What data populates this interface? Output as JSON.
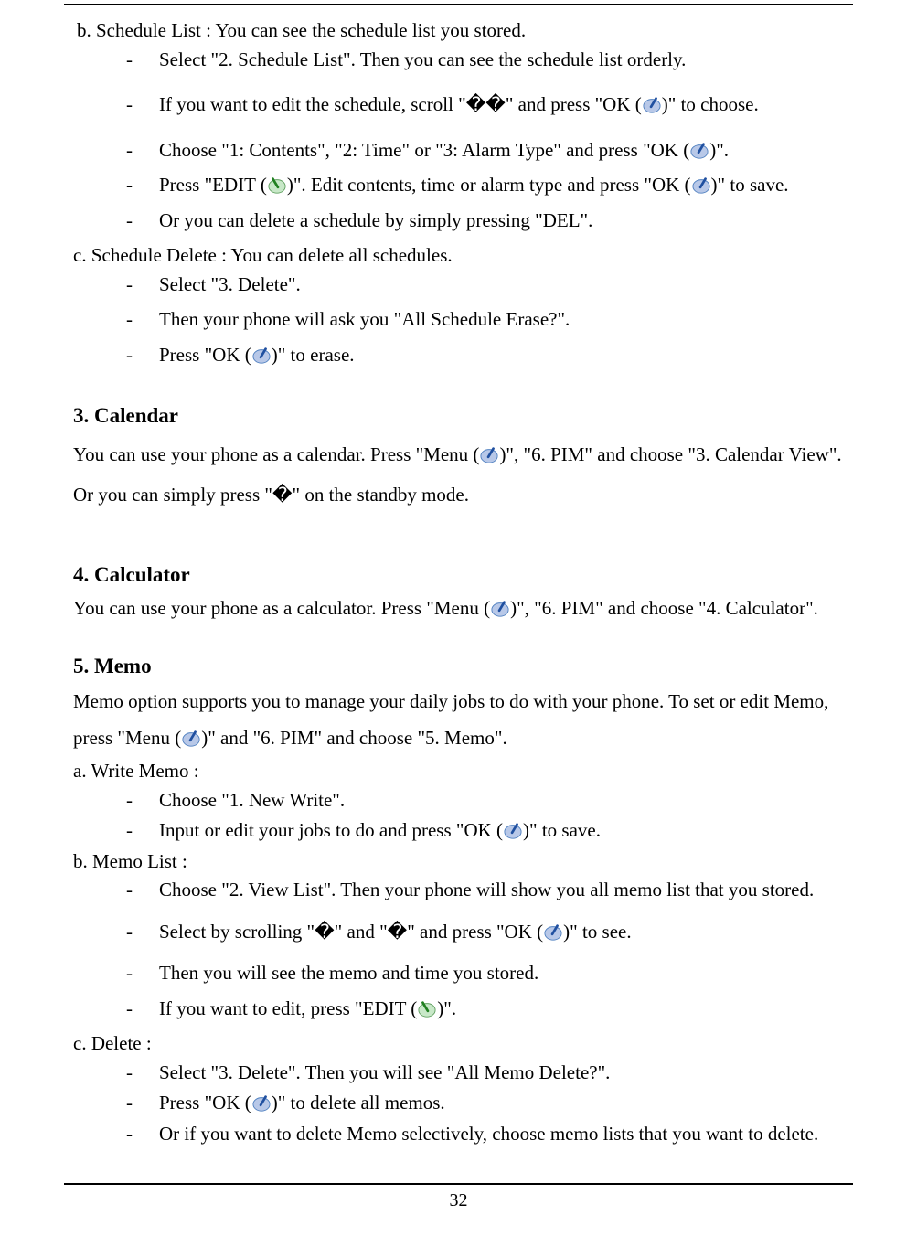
{
  "page_number": "32",
  "section_b": {
    "title": "b. Schedule List : You can see the schedule list you stored.",
    "items": [
      "Select \"2. Schedule List\". Then you can see the schedule list orderly.",
      "If you want to edit the schedule, scroll \"��\" and press \"OK ( )\" to choose.",
      "Choose \"1: Contents\", \"2: Time\" or \"3: Alarm Type\" and press \"OK ( )\".",
      "Press \"EDIT ( )\". Edit contents, time or alarm type and press \"OK ( )\" to save.",
      "Or you can delete a schedule by simply pressing \"DEL\"."
    ]
  },
  "section_c": {
    "title": "c. Schedule Delete : You can delete all schedules.",
    "items": [
      "Select \"3. Delete\".",
      "Then your phone will ask you \"All Schedule Erase?\".",
      "Press \"OK ( )\" to erase."
    ]
  },
  "sec3": {
    "heading": "3. Calendar",
    "body": "You can use your phone as a calendar. Press \"Menu ( )\", \"6. PIM\" and choose \"3. Calendar View\". Or you can simply press \"�\" on the standby mode."
  },
  "sec4": {
    "heading": "4. Calculator",
    "body": "You can use your phone as a calculator. Press \"Menu ( )\", \"6. PIM\" and choose \"4. Calculator\"."
  },
  "sec5": {
    "heading": "5. Memo",
    "intro": "Memo option supports you to manage your daily jobs to do with your phone. To set or edit Memo, press \"Menu ( )\" and \"6. PIM\" and choose \"5. Memo\".",
    "a_title": "a. Write Memo :",
    "a_items": [
      "Choose \"1. New Write\".",
      "Input or edit your jobs to do and press \"OK ( )\" to save."
    ],
    "b_title": "b. Memo List :",
    "b_items": [
      "Choose \"2. View List\". Then your phone will show you all memo list that you stored.",
      "Select by scrolling \"�\" and \"�\" and press \"OK ( )\" to see.",
      "Then you will see the memo and time you stored.",
      "If you want to edit, press \"EDIT ( )\"."
    ],
    "c_title": "c. Delete :",
    "c_items": [
      "Select \"3. Delete\". Then you will see \"All Memo Delete?\".",
      "Press \"OK ( )\" to delete all memos.",
      "Or if you want to delete Memo selectively, choose memo lists that you want to delete."
    ]
  }
}
